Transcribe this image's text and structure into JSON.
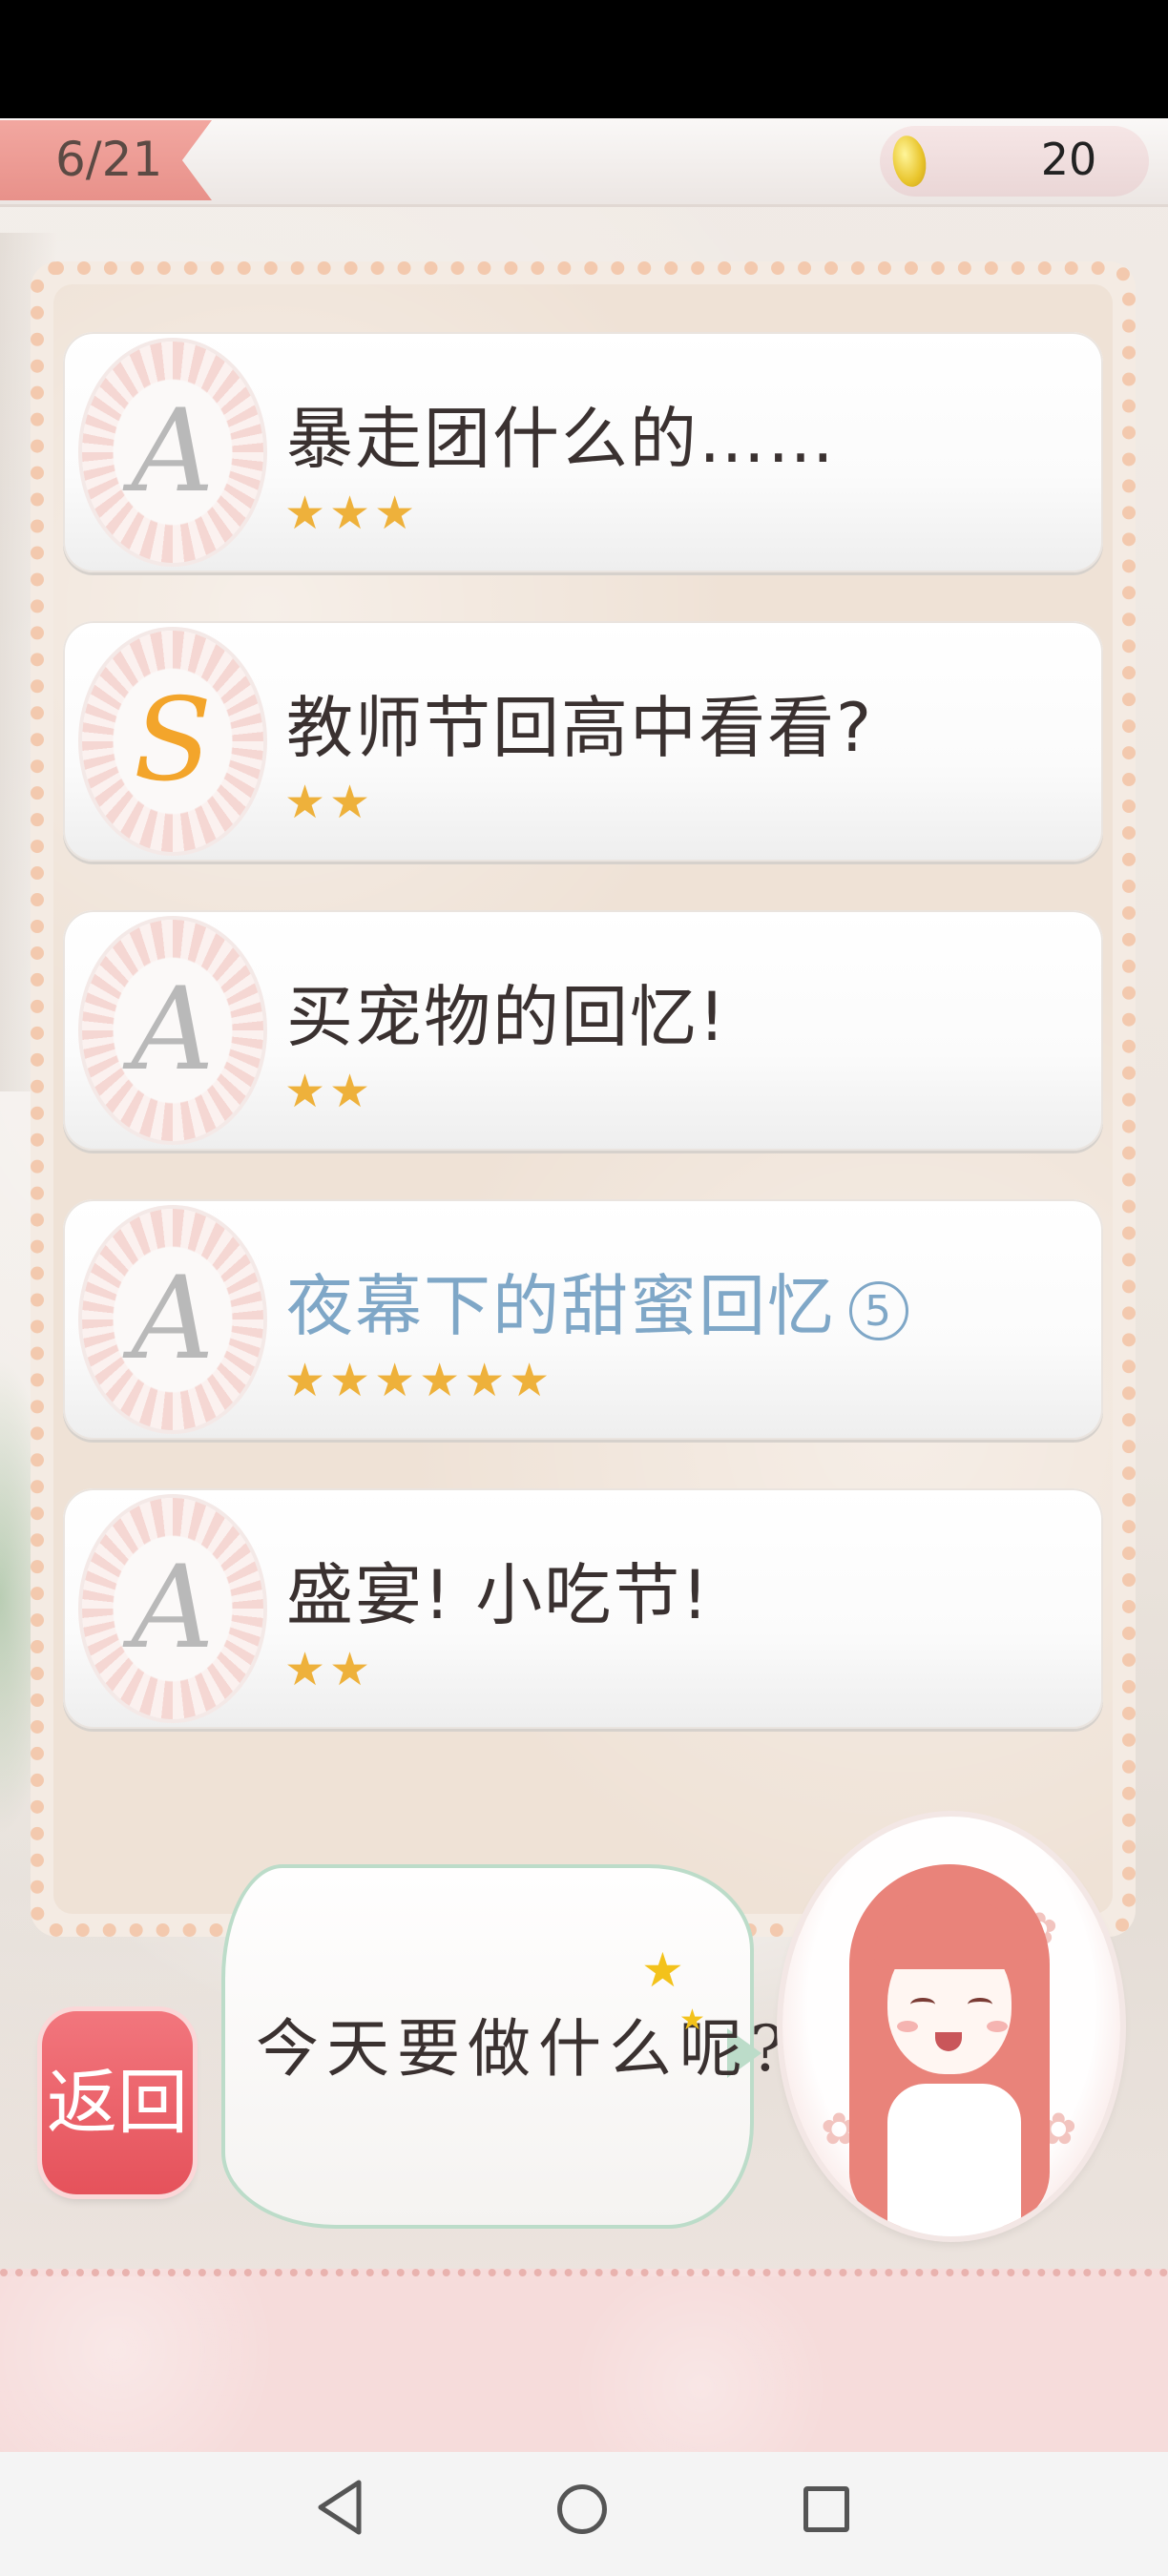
{
  "header": {
    "progress": "6/21",
    "coins": "20"
  },
  "quests": [
    {
      "rank": "A",
      "title": "暴走团什么的……",
      "stars": "★★★",
      "rating": 3
    },
    {
      "rank": "S",
      "title": "教师节回高中看看?",
      "stars": "★★",
      "rating": 2
    },
    {
      "rank": "A",
      "title": "买宠物的回忆!",
      "stars": "★★",
      "rating": 2
    },
    {
      "rank": "A",
      "title": "夜幕下的甜蜜回忆",
      "badge": "5",
      "stars": "★★★★★★",
      "rating": 6
    },
    {
      "rank": "A",
      "title": "盛宴! 小吃节!",
      "stars": "★★",
      "rating": 2
    }
  ],
  "footer": {
    "back_label": "返回",
    "speech": "今天要做什么呢?"
  },
  "colors": {
    "accent_pink": "#e5525b",
    "star": "#eeb13b",
    "special_title": "#7fa7c7"
  },
  "icons": {
    "coin": "coin-icon",
    "nav_back": "triangle-back-icon",
    "nav_home": "circle-home-icon",
    "nav_recent": "square-recent-icon"
  }
}
